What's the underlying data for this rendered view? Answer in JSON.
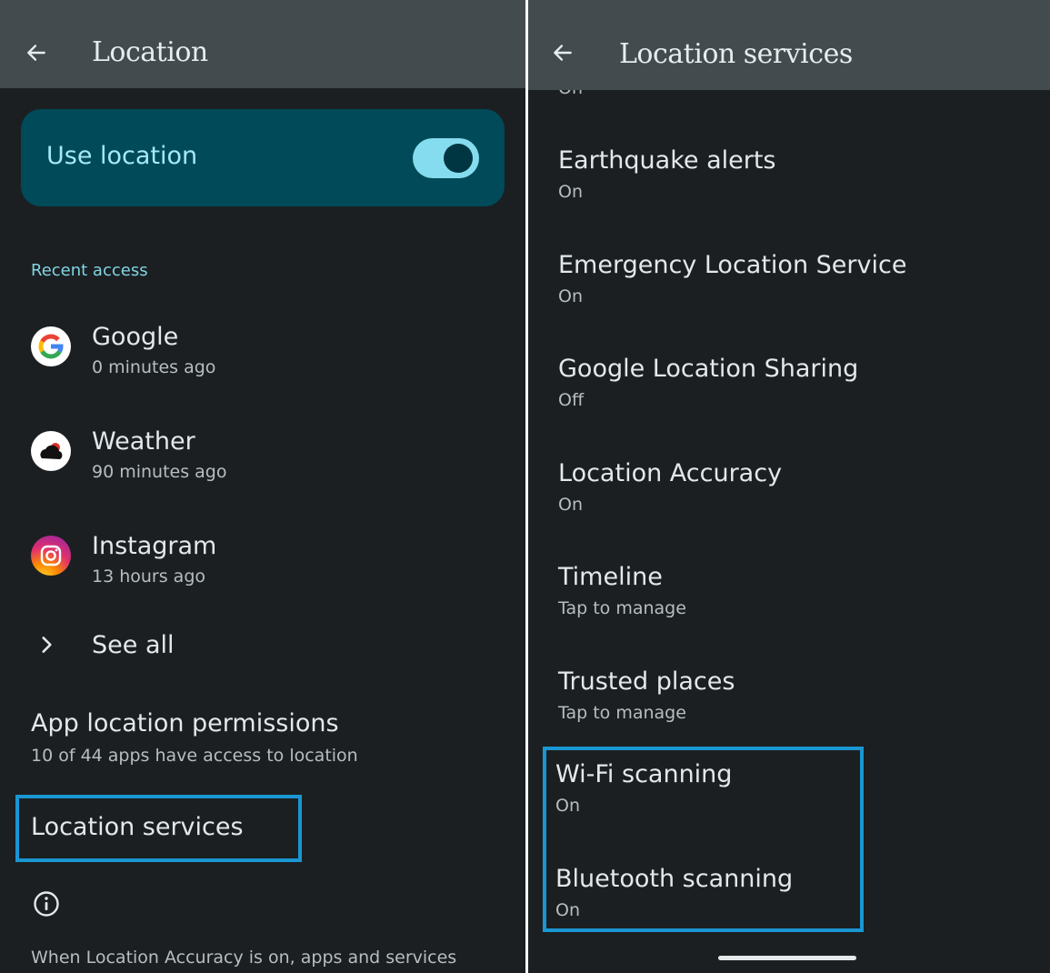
{
  "left": {
    "title": "Location",
    "use_location": {
      "label": "Use location",
      "enabled": true
    },
    "recent_access": {
      "header": "Recent access",
      "apps": [
        {
          "name": "Google",
          "time": "0 minutes ago",
          "icon": "google-icon"
        },
        {
          "name": "Weather",
          "time": "90 minutes ago",
          "icon": "weather-icon"
        },
        {
          "name": "Instagram",
          "time": "13 hours ago",
          "icon": "instagram-icon"
        }
      ],
      "see_all": "See all"
    },
    "app_permissions": {
      "title": "App location permissions",
      "summary": "10 of 44 apps have access to location"
    },
    "location_services": {
      "title": "Location services"
    },
    "footer": "When Location Accuracy is on, apps and services"
  },
  "right": {
    "title": "Location services",
    "partial_summary": "On",
    "items": [
      {
        "title": "Earthquake alerts",
        "summary": "On"
      },
      {
        "title": "Emergency Location Service",
        "summary": "On"
      },
      {
        "title": "Google Location Sharing",
        "summary": "Off"
      },
      {
        "title": "Location Accuracy",
        "summary": "On"
      },
      {
        "title": "Timeline",
        "summary": "Tap to manage"
      },
      {
        "title": "Trusted places",
        "summary": "Tap to manage"
      },
      {
        "title": "Wi-Fi scanning",
        "summary": "On"
      },
      {
        "title": "Bluetooth scanning",
        "summary": "On"
      }
    ]
  },
  "colors": {
    "background": "#1b1f21",
    "app_bar": "#434b4e",
    "toggle_card": "#004a59",
    "accent": "#83d4e4",
    "highlight_border": "#1a96d2"
  }
}
